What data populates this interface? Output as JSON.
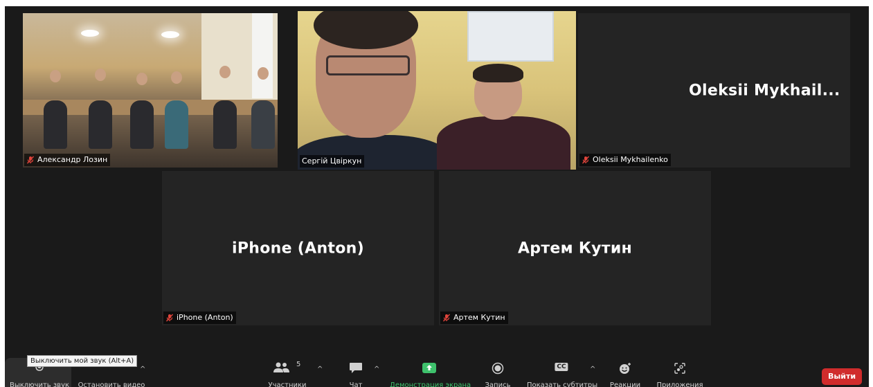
{
  "participants": {
    "tile1": {
      "name": "Александр Лозин",
      "muted": true
    },
    "tile2": {
      "name": "Сергій Цвіркун",
      "muted": false,
      "active": true
    },
    "tile3": {
      "name": "Oleksii Mykhailenko",
      "display": "Oleksii  Mykhail...",
      "muted": true
    },
    "tile4": {
      "name": "iPhone (Anton)",
      "display": "iPhone (Anton)",
      "muted": true
    },
    "tile5": {
      "name": "Артем Кутин",
      "display": "Артем Кутин",
      "muted": true
    }
  },
  "toolbar": {
    "mute_label": "Выключить звук",
    "video_label": "Остановить видео",
    "participants_label": "Участники",
    "participants_count": "5",
    "chat_label": "Чат",
    "share_label": "Демонстрация экрана",
    "record_label": "Запись",
    "captions_label": "Показать субтитры",
    "reactions_label": "Реакции",
    "apps_label": "Приложения",
    "leave_label": "Выйти",
    "cc_text": "CC",
    "caret": "^"
  },
  "tooltip": {
    "text": "Выключить мой звук (Alt+A)"
  },
  "colors": {
    "active_border": "#c6e377",
    "share_green": "#3ec16c",
    "leave_red": "#d02c2c",
    "muted_red": "#e0443b"
  }
}
